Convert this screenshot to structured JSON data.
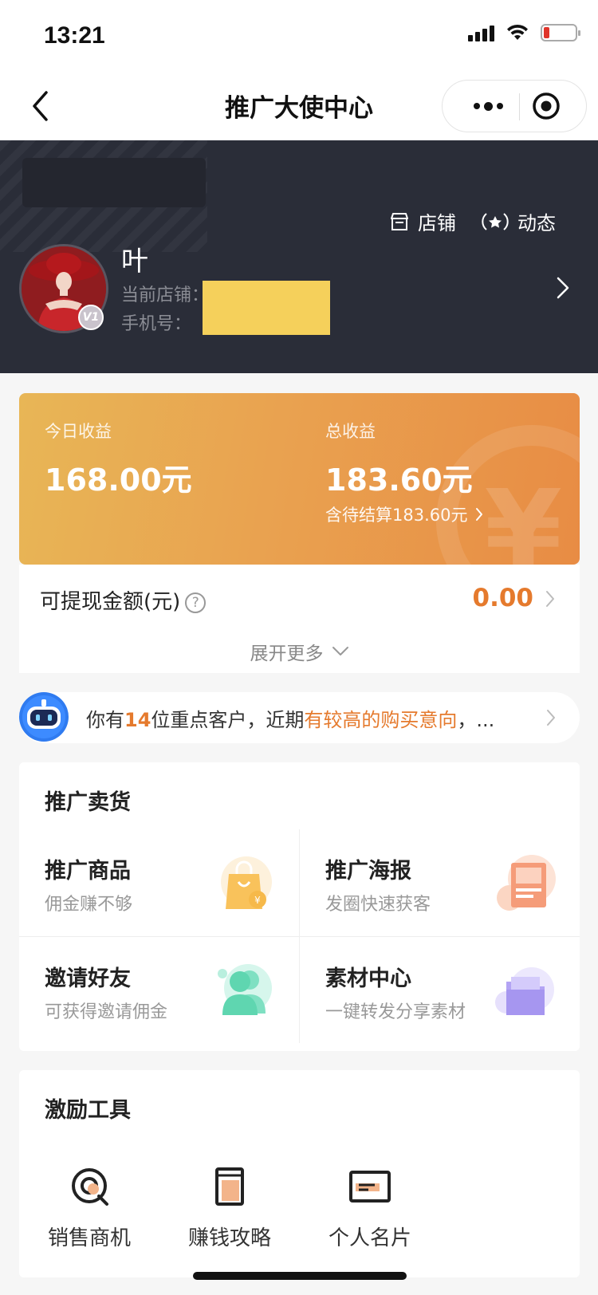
{
  "status_bar": {
    "time": "13:21"
  },
  "nav": {
    "title": "推广大使中心"
  },
  "header": {
    "store_link": "店铺",
    "activity_link": "动态",
    "user_name": "叶",
    "store_label": "当前店铺：",
    "phone_label": "手机号：",
    "level_badge": "V1"
  },
  "earnings": {
    "today_label": "今日收益",
    "today_value": "168.00元",
    "total_label": "总收益",
    "total_value": "183.60元",
    "pending_note": "含待结算183.60元"
  },
  "withdraw": {
    "label": "可提现金额(元)",
    "help": "?",
    "value": "0.00",
    "expand_label": "展开更多"
  },
  "notice": {
    "prefix": "你有",
    "count": "14",
    "middle": "位重点客户，近期",
    "highlight": "有较高的购买意向",
    "suffix": "，..."
  },
  "promote": {
    "title": "推广卖货",
    "items": [
      {
        "title": "推广商品",
        "subtitle": "佣金赚不够",
        "icon": "shopping-bag-icon"
      },
      {
        "title": "推广海报",
        "subtitle": "发圈快速获客",
        "icon": "poster-icon"
      },
      {
        "title": "邀请好友",
        "subtitle": "可获得邀请佣金",
        "icon": "friends-icon"
      },
      {
        "title": "素材中心",
        "subtitle": "一键转发分享素材",
        "icon": "folder-icon"
      }
    ]
  },
  "tools": {
    "title": "激励工具",
    "items": [
      {
        "label": "销售商机",
        "icon": "opportunity-icon"
      },
      {
        "label": "赚钱攻略",
        "icon": "guide-book-icon"
      },
      {
        "label": "个人名片",
        "icon": "business-card-icon"
      }
    ]
  },
  "colors": {
    "accent_orange": "#e57a2d",
    "header_dark": "#2a2d38",
    "card_gradient_start": "#e8b656",
    "card_gradient_end": "#e88c44"
  }
}
